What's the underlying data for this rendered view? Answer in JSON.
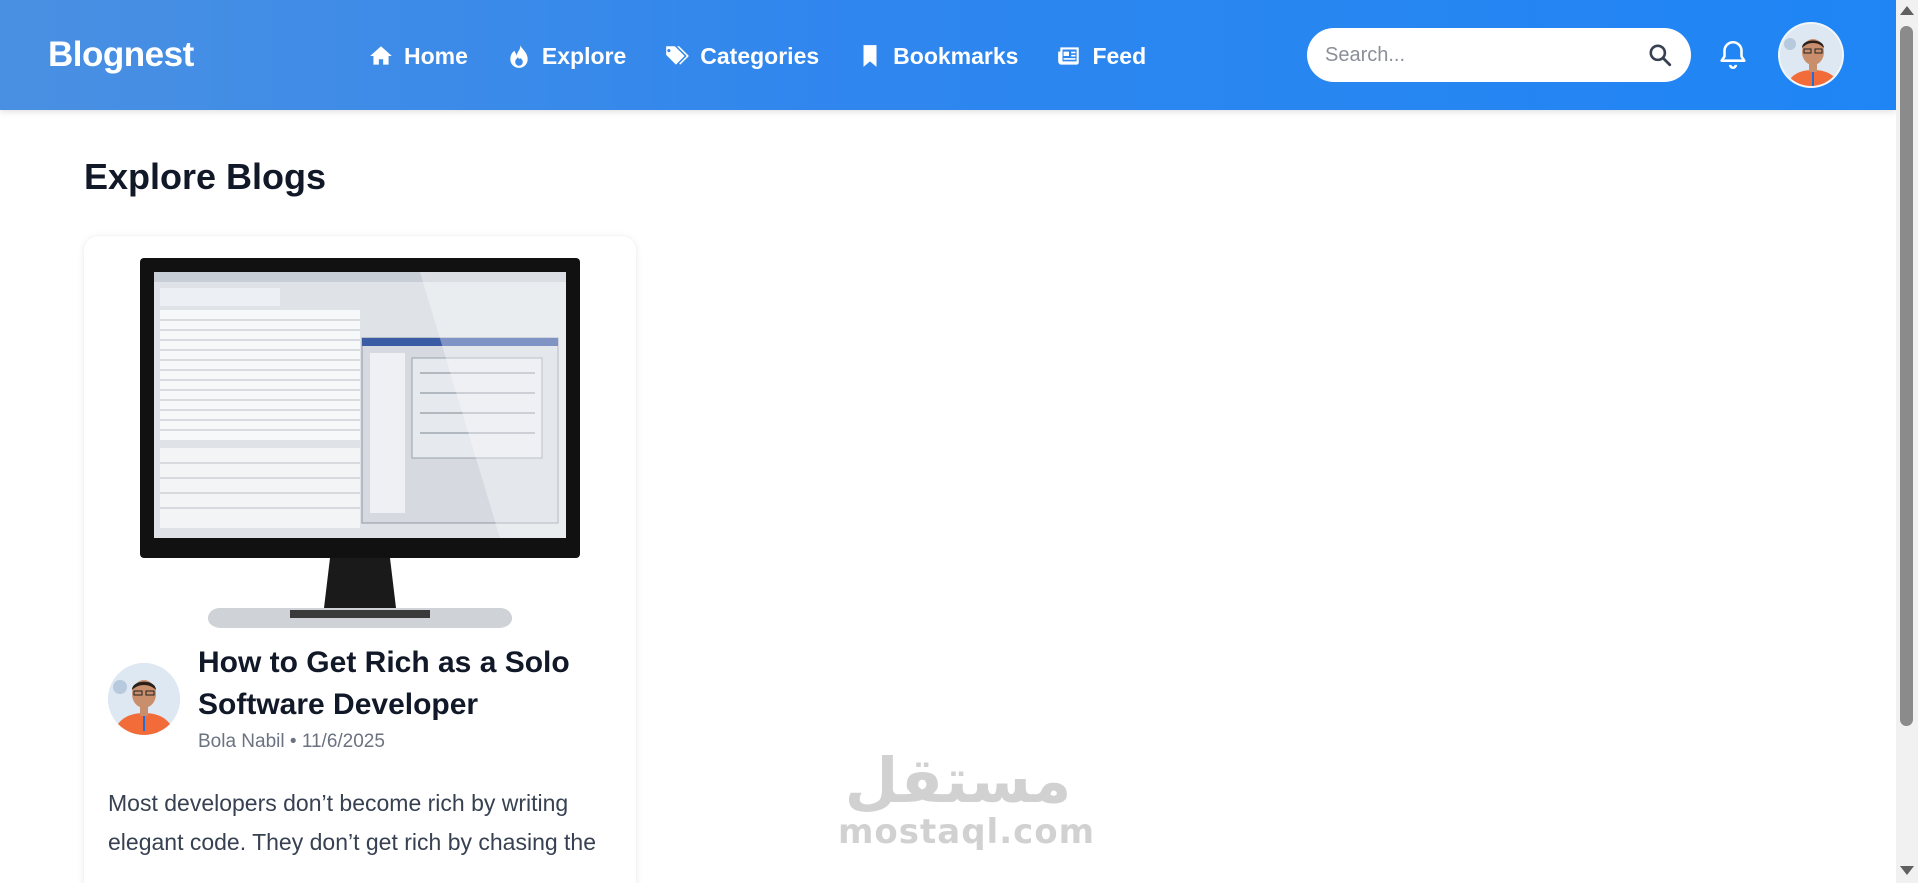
{
  "brand": "Blognest",
  "colors": {
    "nav_gradient_start": "#4a90e2",
    "nav_gradient_end": "#1f85f5",
    "text_dark": "#111827",
    "text_muted": "#6b7280"
  },
  "nav": {
    "items": [
      {
        "label": "Home",
        "icon": "home-icon"
      },
      {
        "label": "Explore",
        "icon": "fire-icon"
      },
      {
        "label": "Categories",
        "icon": "tags-icon"
      },
      {
        "label": "Bookmarks",
        "icon": "bookmark-icon"
      },
      {
        "label": "Feed",
        "icon": "newspaper-icon"
      }
    ],
    "search_placeholder": "Search...",
    "notification_icon": "bell-icon",
    "avatar_icon": "user-avatar"
  },
  "page": {
    "title": "Explore Blogs"
  },
  "posts": [
    {
      "title": "How to Get Rich as a Solo Software Developer",
      "author": "Bola Nabil",
      "separator": "•",
      "date": "11/6/2025",
      "excerpt": "Most developers don’t become rich by writing elegant code. They don’t get rich by chasing the",
      "image_icon": "computer-monitor-image"
    }
  ],
  "watermark": {
    "arabic": "مستقل",
    "latin": "mostaql.com"
  }
}
